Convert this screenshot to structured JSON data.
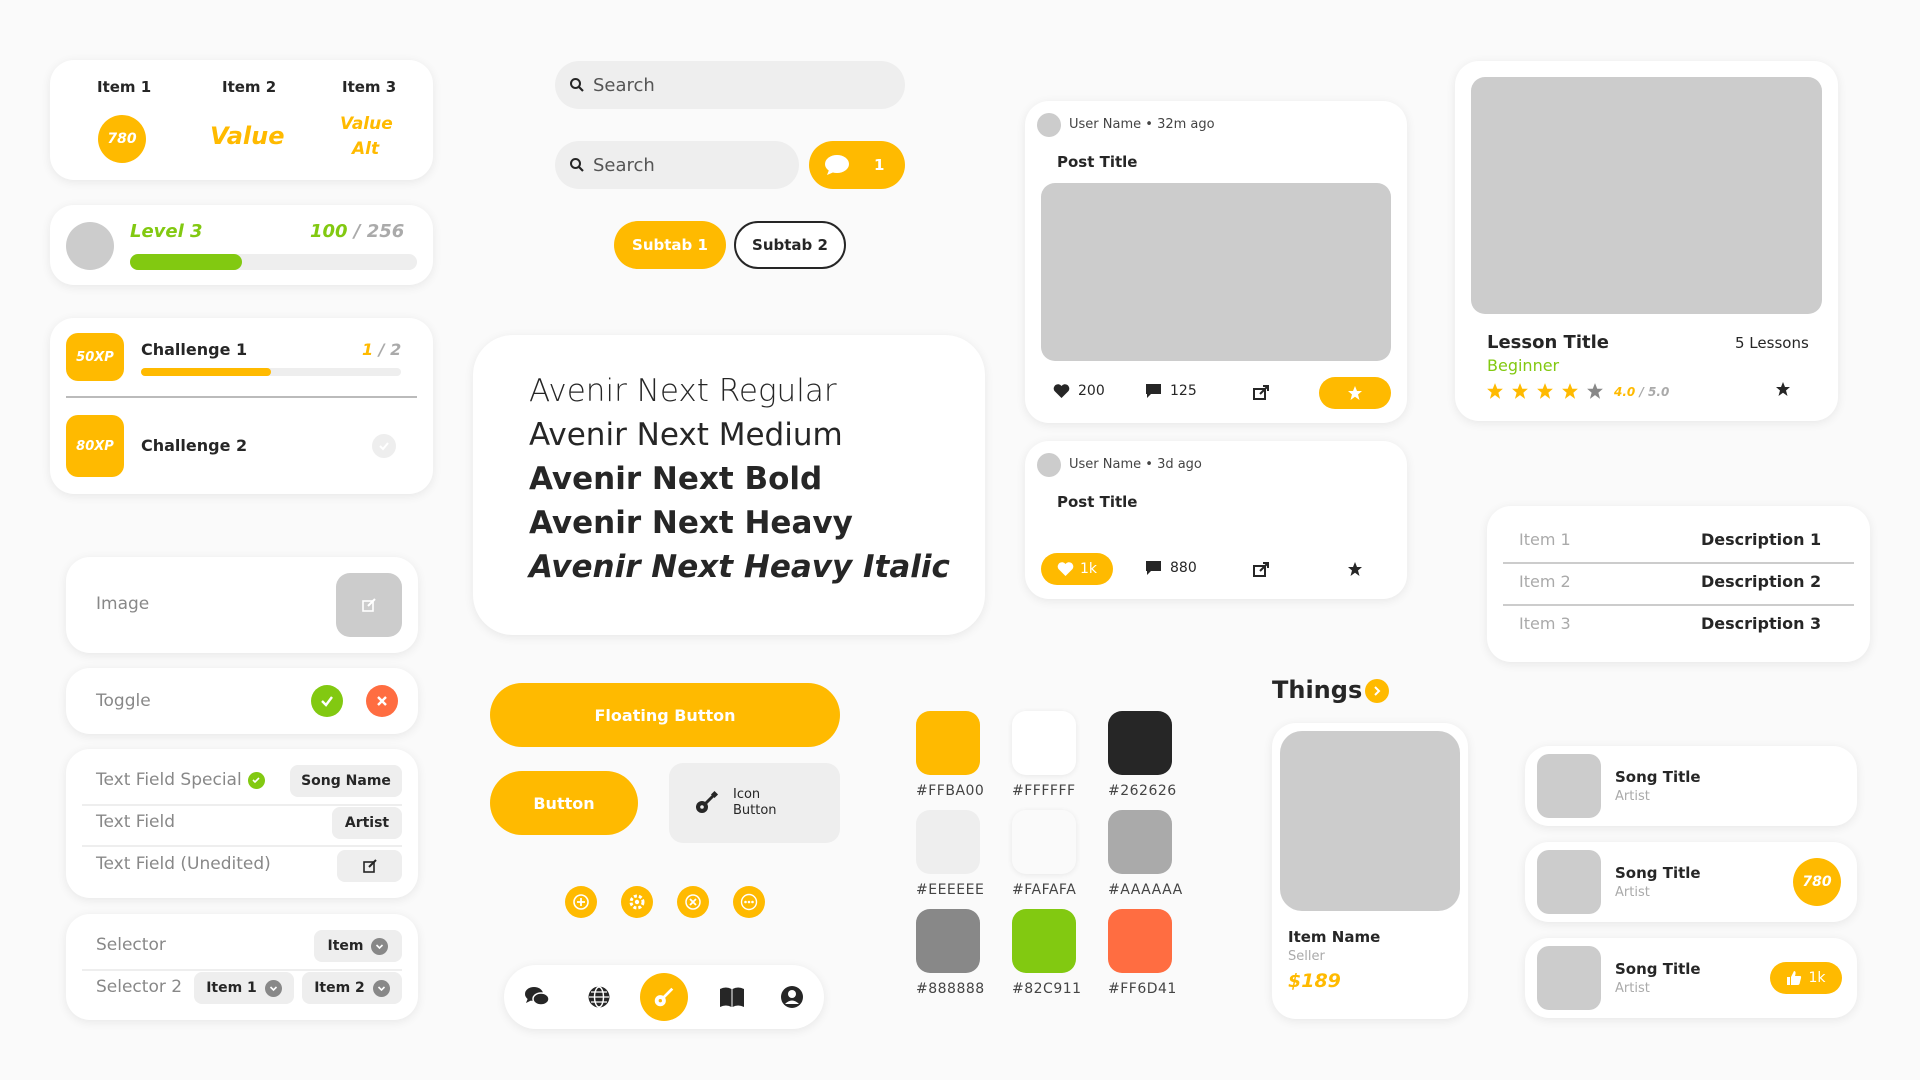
{
  "stats_card": {
    "col1_label": "Item 1",
    "col1_badge": "780",
    "col2_label": "Item 2",
    "col2_value": "Value",
    "col3_label": "Item 3",
    "col3_value_line1": "Value",
    "col3_value_line2": "Alt"
  },
  "level_card": {
    "level": "Level 3",
    "current": "100",
    "separator": "/",
    "total": "256",
    "progress": 0.39
  },
  "challenges": {
    "items": [
      {
        "xp": "50XP",
        "title": "Challenge 1",
        "current": "1",
        "separator": "/",
        "total": "2",
        "progress": 0.5
      },
      {
        "xp": "80XP",
        "title": "Challenge 2"
      }
    ]
  },
  "image_row": {
    "label": "Image"
  },
  "toggle_row": {
    "label": "Toggle"
  },
  "text_fields": {
    "rows": [
      {
        "label": "Text Field Special",
        "value": "Song Name"
      },
      {
        "label": "Text Field",
        "value": "Artist"
      },
      {
        "label": "Text Field (Unedited)"
      }
    ]
  },
  "selectors": {
    "row1_label": "Selector",
    "row1_value": "Item",
    "row2_label": "Selector 2",
    "row2_value1": "Item 1",
    "row2_value2": "Item 2"
  },
  "search": {
    "placeholder1": "Search",
    "placeholder2": "Search",
    "chat_count": "1"
  },
  "subtabs": {
    "tab1": "Subtab 1",
    "tab2": "Subtab 2"
  },
  "typography": {
    "regular": "Avenir Next Regular",
    "medium": "Avenir Next Medium",
    "bold": "Avenir Next Bold",
    "heavy": "Avenir Next Heavy",
    "heavy_italic": "Avenir Next Heavy Italic"
  },
  "buttons": {
    "floating": "Floating Button",
    "button": "Button",
    "icon_button_line1": "Icon",
    "icon_button_line2": "Button"
  },
  "swatches": [
    {
      "hex": "#FFBA00",
      "label": "#FFBA00"
    },
    {
      "hex": "#FFFFFF",
      "label": "#FFFFFF"
    },
    {
      "hex": "#262626",
      "label": "#262626"
    },
    {
      "hex": "#EEEEEE",
      "label": "#EEEEEE"
    },
    {
      "hex": "#FAFAFA",
      "label": "#FAFAFA"
    },
    {
      "hex": "#AAAAAA",
      "label": "#AAAAAA"
    },
    {
      "hex": "#888888",
      "label": "#888888"
    },
    {
      "hex": "#82C911",
      "label": "#82C911"
    },
    {
      "hex": "#FF6D41",
      "label": "#FF6D41"
    }
  ],
  "post1": {
    "user": "User Name",
    "time": "32m ago",
    "title": "Post Title",
    "likes": "200",
    "comments": "125"
  },
  "post2": {
    "user": "User Name",
    "time": "3d ago",
    "title": "Post Title",
    "likes": "1k",
    "comments": "880"
  },
  "things": {
    "heading": "Things",
    "item_name": "Item Name",
    "seller": "Seller",
    "price": "$189"
  },
  "lesson": {
    "title": "Lesson Title",
    "lessons": "5 Lessons",
    "level": "Beginner",
    "rating": "4.0",
    "separator": "/",
    "max": "5.0",
    "stars": 4
  },
  "description_table": {
    "rows": [
      {
        "item": "Item 1",
        "desc": "Description 1"
      },
      {
        "item": "Item 2",
        "desc": "Description 2"
      },
      {
        "item": "Item 3",
        "desc": "Description 3"
      }
    ]
  },
  "songs": [
    {
      "title": "Song Title",
      "artist": "Artist"
    },
    {
      "title": "Song Title",
      "artist": "Artist",
      "badge": "780"
    },
    {
      "title": "Song Title",
      "artist": "Artist",
      "likes": "1k"
    }
  ],
  "colors": {
    "accent": "#FFBA00",
    "dark": "#262626",
    "green": "#82C911",
    "red": "#FF6D41",
    "placeholder": "#CCCCCC"
  }
}
